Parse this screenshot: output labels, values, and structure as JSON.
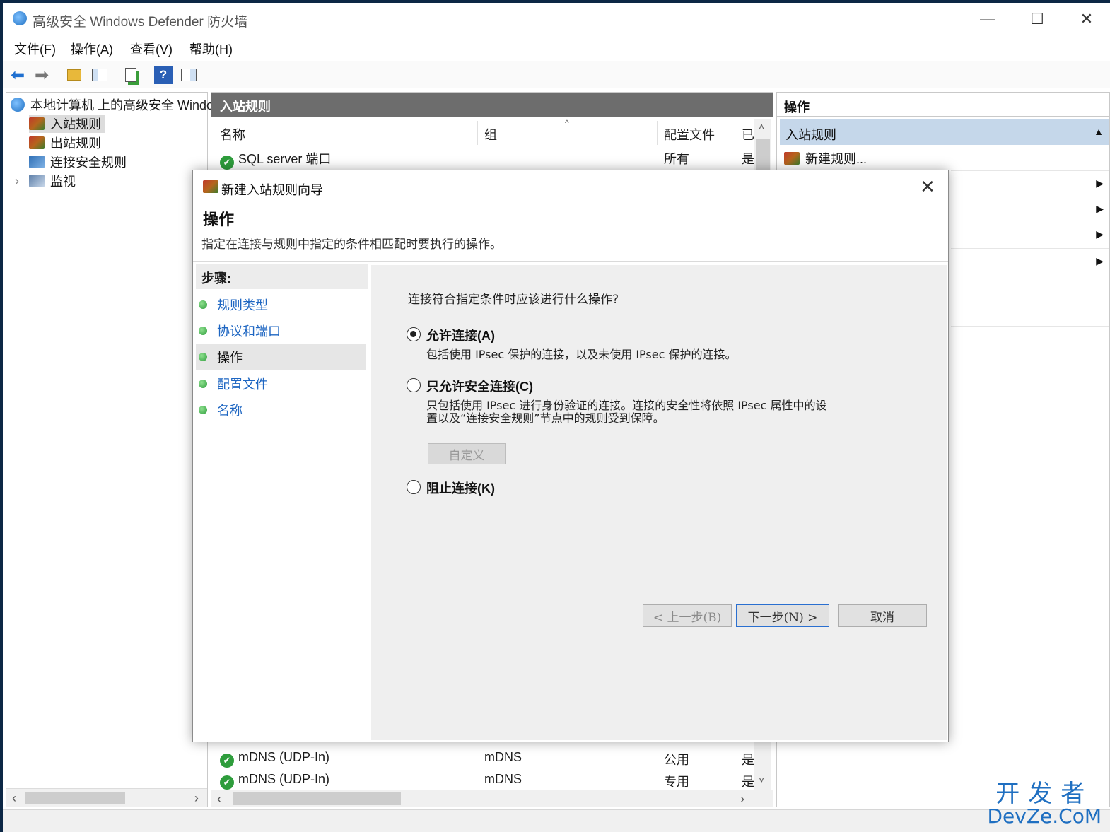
{
  "window": {
    "title": "高级安全 Windows Defender 防火墙",
    "minimize": "—",
    "maximize": "☐",
    "close": "✕"
  },
  "menu": [
    "文件(F)",
    "操作(A)",
    "查看(V)",
    "帮助(H)"
  ],
  "tree": {
    "root": "本地计算机 上的高级安全 Windows Defender 防火墙",
    "items": [
      "入站规则",
      "出站规则",
      "连接安全规则",
      "监视"
    ],
    "expander": "›"
  },
  "center": {
    "header": "入站规则",
    "columns": [
      "名称",
      "组",
      "配置文件",
      "已"
    ],
    "rows_top": [
      {
        "name": "SQL server 端口",
        "group": "",
        "profile": "所有",
        "enabled": "是"
      }
    ],
    "rows_bottom": [
      {
        "name": "mDNS (UDP-In)",
        "group": "mDNS",
        "profile": "公用",
        "enabled": "是"
      },
      {
        "name": "mDNS (UDP-In)",
        "group": "mDNS",
        "profile": "专用",
        "enabled": "是"
      }
    ]
  },
  "actions": {
    "header": "操作",
    "section": "入站规则",
    "new_rule": "新建规则..."
  },
  "dialog": {
    "title": "新建入站规则向导",
    "close": "✕",
    "heading": "操作",
    "description": "指定在连接与规则中指定的条件相匹配时要执行的操作。",
    "steps_title": "步骤:",
    "steps": [
      "规则类型",
      "协议和端口",
      "操作",
      "配置文件",
      "名称"
    ],
    "current_step": 2,
    "question": "连接符合指定条件时应该进行什么操作?",
    "options": [
      {
        "label": "允许连接(A)",
        "desc": "包括使用 IPsec 保护的连接，以及未使用 IPsec 保护的连接。",
        "selected": true
      },
      {
        "label": "只允许安全连接(C)",
        "desc1": "只包括使用 IPsec 进行身份验证的连接。连接的安全性将依照 IPsec 属性中的设",
        "desc2": "置以及“连接安全规则”节点中的规则受到保障。",
        "selected": false
      },
      {
        "label": "阻止连接(K)",
        "selected": false
      }
    ],
    "customize": "自定义",
    "back": "< 上一步(B)",
    "next": "下一步(N) >",
    "cancel": "取消"
  },
  "watermark": {
    "line1": "开发者",
    "line2": "DevZe.CoM"
  }
}
